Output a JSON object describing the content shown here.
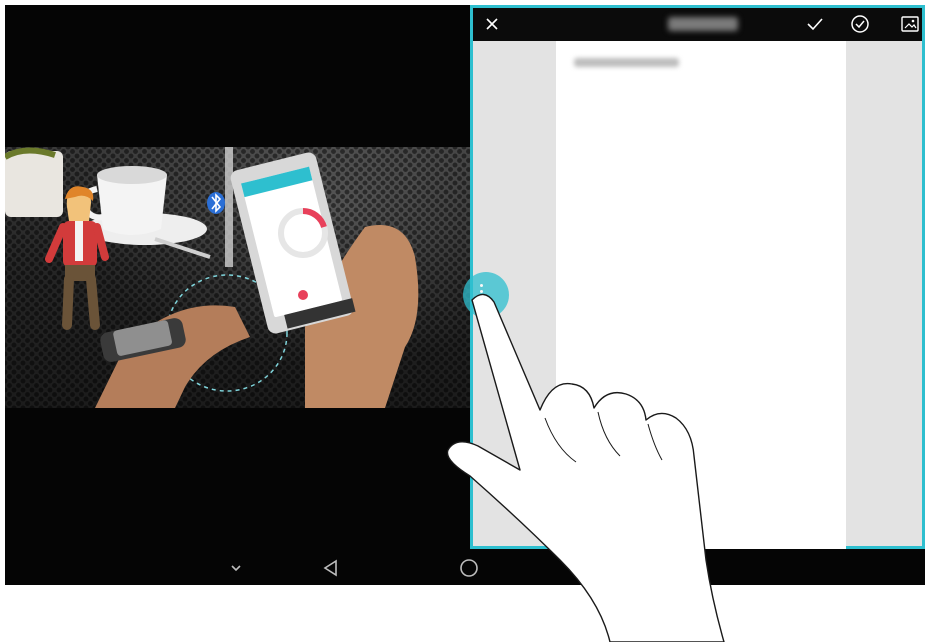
{
  "floating_window": {
    "title": "••••••••",
    "document_line": "••••••••••••••••••",
    "toolbar_icons": [
      "close-icon",
      "checkmark-icon",
      "check-circle-icon",
      "image-icon"
    ]
  },
  "navbar": {
    "icons": [
      "chevron-down-icon",
      "back-triangle-icon",
      "home-circle-icon"
    ]
  },
  "colors": {
    "accent": "#2ebfcf",
    "screen_bg": "#050505",
    "toolbar_bg": "#0b0b0b",
    "page_margin": "#e3e3e3"
  }
}
